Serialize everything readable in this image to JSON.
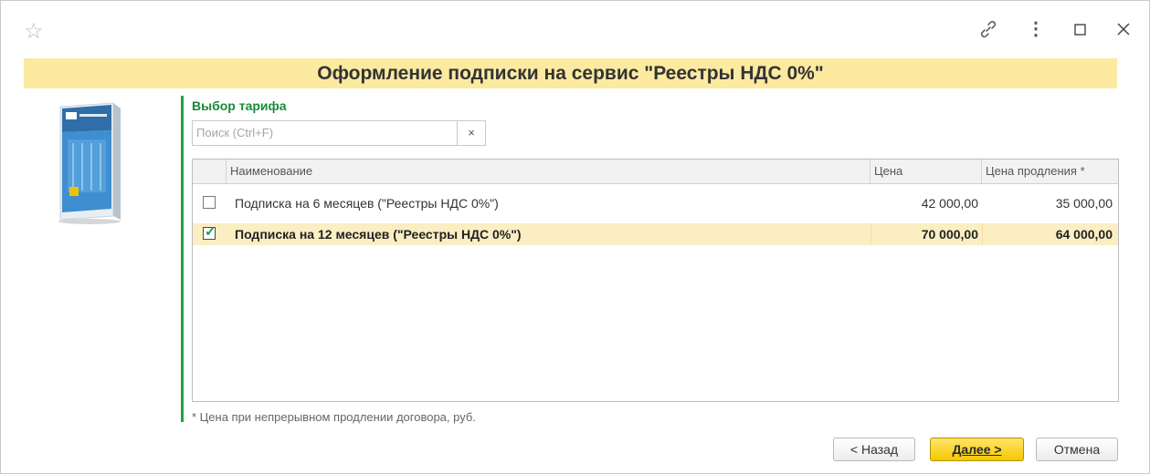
{
  "titlebar": {
    "icons": [
      "star-icon",
      "link-icon",
      "more-icon",
      "maximize-icon",
      "close-icon"
    ]
  },
  "banner": {
    "title": "Оформление подписки на сервис \"Реестры НДС 0%\""
  },
  "section": {
    "title": "Выбор тарифа"
  },
  "search": {
    "placeholder": "Поиск (Ctrl+F)",
    "value": "",
    "clear_label": "×"
  },
  "table": {
    "columns": [
      "Наименование",
      "Цена",
      "Цена продления *"
    ],
    "rows": [
      {
        "checked": false,
        "name": "Подписка на 6 месяцев (\"Реестры НДС 0%\")",
        "price": "42 000,00",
        "renew_price": "35 000,00"
      },
      {
        "checked": true,
        "name": "Подписка на 12 месяцев (\"Реестры НДС 0%\")",
        "price": "70 000,00",
        "renew_price": "64 000,00"
      }
    ]
  },
  "footnote": "*  Цена при непрерывном продлении договора, руб.",
  "buttons": {
    "back": "< Назад",
    "next": "Далее >",
    "cancel": "Отмена"
  },
  "colors": {
    "banner": "#fbeaa0",
    "accent_green": "#178a3b",
    "selected_row": "#fbeec3",
    "primary_button": "#f5c800"
  }
}
